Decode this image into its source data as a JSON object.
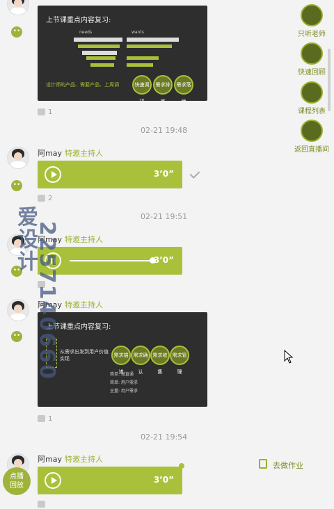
{
  "messages": [
    {
      "like_count": "1",
      "timestamp": "02-21 19:48"
    },
    {
      "name": "阿may",
      "role": "特邀主持人",
      "duration": "3’0”",
      "like_count": "2",
      "timestamp": "02-21 19:51"
    },
    {
      "name": "阿may",
      "role": "特邀主持人",
      "duration": "3’0”"
    },
    {
      "name": "阿may",
      "role": "特邀主持人",
      "like_count": "1",
      "timestamp": "02-21 19:54"
    },
    {
      "name": "阿may",
      "role": "特邀主持人",
      "duration": "3’0”"
    }
  ],
  "slide1": {
    "title": "上节课重点内容复习:",
    "labels": [
      "needs",
      "wants"
    ],
    "footer": "设计师的产品、需要产品、上周调",
    "circles": [
      "快速调研",
      "需求排序",
      "需求落地"
    ]
  },
  "slide2": {
    "title": "上节课重点内容复习:",
    "left_text": "从需求出发到用户价值实现",
    "circles": [
      "需求描述",
      "需求确认",
      "需求收集",
      "需求管理"
    ],
    "notes": [
      "简单: 做直通",
      "简单: 用户需求",
      "全量: 用户需求"
    ]
  },
  "sidebar": {
    "items": [
      {
        "label": "只听老师",
        "icon": "headphones-icon"
      },
      {
        "label": "快速回顾",
        "icon": "review-icon"
      },
      {
        "label": "课程列表",
        "icon": "list-icon"
      },
      {
        "label": "返回直播间",
        "icon": "return-icon"
      }
    ],
    "homework": "去做作业"
  },
  "floating": {
    "badge_line1": "点播",
    "badge_line2": "回放"
  },
  "watermark": {
    "line1": "爱设计",
    "line2": "2257140660"
  },
  "colors": {
    "accent": "#a9c13a",
    "slide_bg": "#2e2e2e",
    "page_bg": "#f3f3f3"
  }
}
